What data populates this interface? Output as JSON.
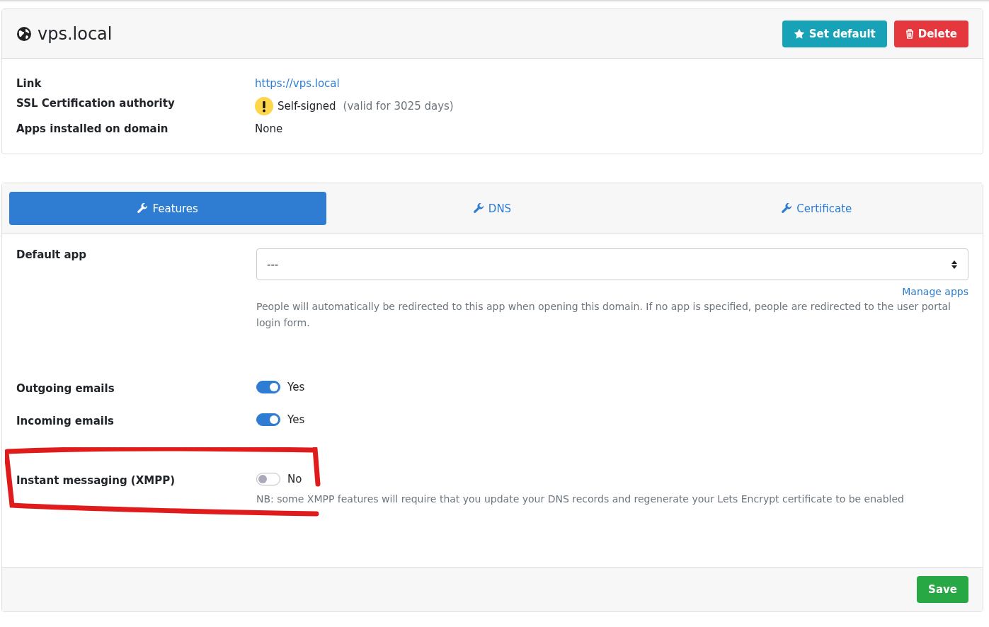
{
  "domain": {
    "title": "vps.local",
    "actions": [
      {
        "kind": "default",
        "label": "Set default"
      },
      {
        "kind": "delete",
        "label": "Delete"
      }
    ],
    "info": [
      {
        "kind": "link",
        "label": "Link",
        "value": "https://vps.local"
      },
      {
        "kind": "cert",
        "label": "SSL Certification authority",
        "value": "Self-signed",
        "detail": "(valid for 3025 days)"
      },
      {
        "kind": "text",
        "label": "Apps installed on domain",
        "value": "None"
      }
    ]
  },
  "tabs": [
    {
      "label": "Features",
      "selected": true
    },
    {
      "label": "DNS",
      "selected": false
    },
    {
      "label": "Certificate",
      "selected": false
    }
  ],
  "default_app": {
    "label": "Default app",
    "value": "---",
    "link": "Manage apps",
    "help": "People will automatically be redirected to this app when opening this domain. If no app is specified, people are redirected to the user portal login form."
  },
  "features": [
    {
      "label": "Outgoing emails",
      "on": true,
      "state": "Yes"
    },
    {
      "label": "Incoming emails",
      "on": true,
      "state": "Yes"
    },
    {
      "label": "Instant messaging (XMPP)",
      "on": false,
      "state": "No",
      "note": "NB: some XMPP features will require that you update your DNS records and regenerate your Lets Encrypt certificate to be enabled",
      "highlighted": true
    }
  ],
  "save": "Save"
}
